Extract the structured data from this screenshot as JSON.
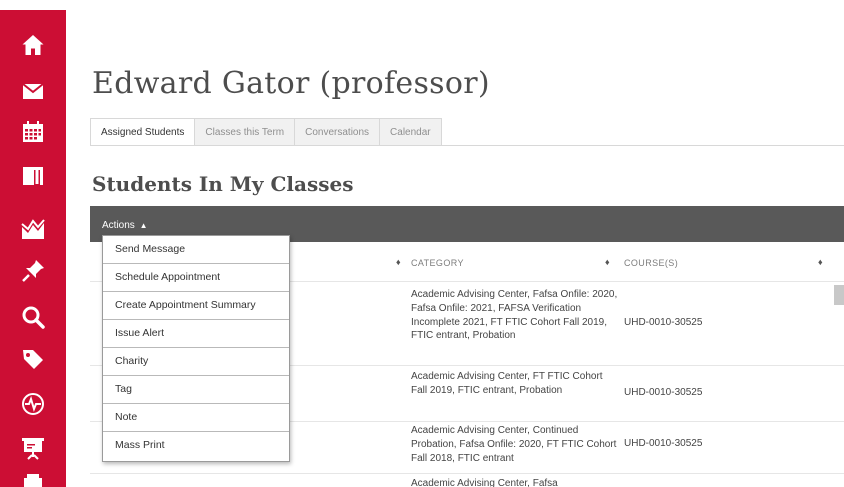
{
  "sidebar": {
    "colors": {
      "background": "#cc0e34",
      "icon": "#ffffff"
    },
    "icons": [
      "home-icon",
      "mail-icon",
      "calendar-icon",
      "book-icon",
      "analytics-chart-icon",
      "pin-icon",
      "search-icon",
      "tag-icon",
      "health-pulse-icon",
      "presentation-icon",
      "printer-icon"
    ]
  },
  "header": {
    "page_title": "Edward Gator (professor)"
  },
  "tabs": [
    {
      "label": "Assigned Students",
      "active": true
    },
    {
      "label": "Classes this Term",
      "active": false
    },
    {
      "label": "Conversations",
      "active": false
    },
    {
      "label": "Calendar",
      "active": false
    }
  ],
  "section": {
    "title": "Students In My Classes"
  },
  "actions": {
    "label": "Actions",
    "menu": [
      "Send Message",
      "Schedule Appointment",
      "Create Appointment Summary",
      "Issue Alert",
      "Charity",
      "Tag",
      "Note",
      "Mass Print"
    ]
  },
  "table": {
    "columns": [
      "CATEGORY",
      "COURSE(S)"
    ],
    "rows": [
      {
        "category": "Academic Advising Center, Fafsa Onfile: 2020, Fafsa Onfile: 2021, FAFSA Verification Incomplete 2021, FT FTIC Cohort Fall 2019, FTIC entrant, Probation",
        "course": "UHD-0010-30525"
      },
      {
        "category": "Academic Advising Center, FT FTIC Cohort Fall 2019, FTIC entrant, Probation",
        "course": "UHD-0010-30525"
      },
      {
        "category": "Academic Advising Center, Continued Probation, Fafsa Onfile: 2020, FT FTIC Cohort Fall 2018, FTIC entrant",
        "course": "UHD-0010-30525"
      },
      {
        "category": "Academic Advising Center, Fafsa",
        "course": ""
      }
    ]
  }
}
